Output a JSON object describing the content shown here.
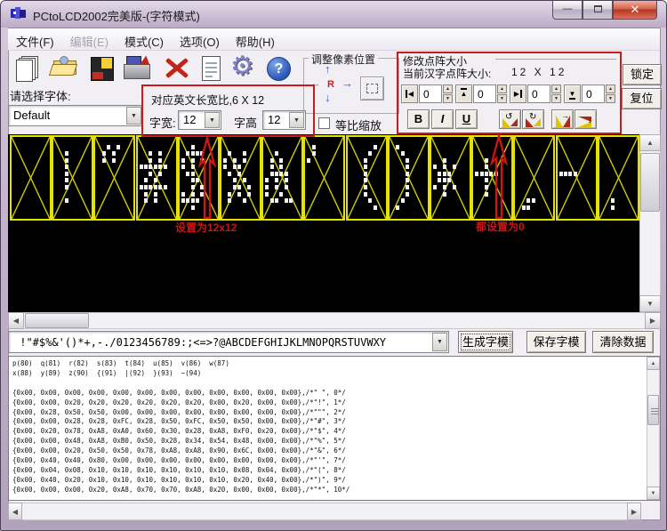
{
  "window": {
    "title": "PCtoLCD2002完美版-(字符模式)"
  },
  "menu": {
    "items": [
      {
        "label": "文件(F)",
        "enabled": true
      },
      {
        "label": "编辑(E)",
        "enabled": false
      },
      {
        "label": "模式(C)",
        "enabled": true
      },
      {
        "label": "选项(O)",
        "enabled": true
      },
      {
        "label": "帮助(H)",
        "enabled": true
      }
    ]
  },
  "toolbar": {
    "icons": [
      "new-file",
      "open-file",
      "save",
      "export-save",
      "delete",
      "notes",
      "settings",
      "help"
    ]
  },
  "font_select": {
    "label": "请选择字体:",
    "value": "Default"
  },
  "char_size_box": {
    "ratio_text": "对应英文长宽比,6 X 12",
    "width_label": "字宽:",
    "width_value": "12",
    "height_label": "字高",
    "height_value": "12"
  },
  "scale_checkbox": {
    "label": "等比缩放",
    "checked": false
  },
  "pixel_pos_group": {
    "title": "调整像素位置",
    "center_label": "R"
  },
  "matrix_box": {
    "title": "修改点阵大小",
    "current_label": "当前汉字点阵大小:",
    "current_value": "12 X 12",
    "margins": [
      {
        "name": "left",
        "value": "0"
      },
      {
        "name": "top",
        "value": "0"
      },
      {
        "name": "right",
        "value": "0"
      },
      {
        "name": "bottom",
        "value": "0"
      }
    ],
    "style_buttons": [
      "B",
      "I",
      "U"
    ]
  },
  "lock_button": "锁定",
  "reset_button": "复位",
  "annotations": {
    "size_note": "设置为12x12",
    "zero_note": "都设置为0"
  },
  "display": {
    "glyphs": [
      {
        "char": " ",
        "rows": [
          "0x00",
          "0x00",
          "0x00",
          "0x00",
          "0x00",
          "0x00",
          "0x00",
          "0x00",
          "0x00",
          "0x00",
          "0x00",
          "0x00"
        ]
      },
      {
        "char": "!",
        "rows": [
          "0x00",
          "0x00",
          "0x20",
          "0x20",
          "0x20",
          "0x20",
          "0x20",
          "0x20",
          "0x00",
          "0x20",
          "0x00",
          "0x00"
        ]
      },
      {
        "char": "\"",
        "rows": [
          "0x00",
          "0x28",
          "0x50",
          "0x50",
          "0x00",
          "0x00",
          "0x00",
          "0x00",
          "0x00",
          "0x00",
          "0x00",
          "0x00"
        ]
      },
      {
        "char": "#",
        "rows": [
          "0x00",
          "0x00",
          "0x28",
          "0x28",
          "0xFC",
          "0x28",
          "0x50",
          "0xFC",
          "0x50",
          "0x50",
          "0x00",
          "0x00"
        ]
      },
      {
        "char": "$",
        "rows": [
          "0x00",
          "0x20",
          "0x78",
          "0xA8",
          "0xA0",
          "0x60",
          "0x30",
          "0x28",
          "0xA8",
          "0xF0",
          "0x20",
          "0x00"
        ]
      },
      {
        "char": "%",
        "rows": [
          "0x00",
          "0x00",
          "0x48",
          "0xA8",
          "0xB0",
          "0x50",
          "0x28",
          "0x34",
          "0x54",
          "0x48",
          "0x00",
          "0x00"
        ]
      },
      {
        "char": "&",
        "rows": [
          "0x00",
          "0x00",
          "0x20",
          "0x50",
          "0x50",
          "0x78",
          "0xA8",
          "0xA8",
          "0x90",
          "0x6C",
          "0x00",
          "0x00"
        ]
      },
      {
        "char": "'",
        "rows": [
          "0x00",
          "0x40",
          "0x40",
          "0x80",
          "0x00",
          "0x00",
          "0x00",
          "0x00",
          "0x00",
          "0x00",
          "0x00",
          "0x00"
        ]
      },
      {
        "char": "(",
        "rows": [
          "0x00",
          "0x04",
          "0x08",
          "0x10",
          "0x10",
          "0x10",
          "0x10",
          "0x10",
          "0x10",
          "0x08",
          "0x04",
          "0x00"
        ]
      },
      {
        "char": ")",
        "rows": [
          "0x00",
          "0x40",
          "0x20",
          "0x10",
          "0x10",
          "0x10",
          "0x10",
          "0x10",
          "0x10",
          "0x20",
          "0x40",
          "0x00"
        ]
      },
      {
        "char": "*",
        "rows": [
          "0x00",
          "0x00",
          "0x00",
          "0x20",
          "0xA8",
          "0x70",
          "0x70",
          "0xA8",
          "0x20",
          "0x00",
          "0x00",
          "0x00"
        ]
      },
      {
        "char": "+",
        "rows": [
          "0x00",
          "0x00",
          "0x00",
          "0x20",
          "0x20",
          "0xF8",
          "0x20",
          "0x20",
          "0x20",
          "0x00",
          "0x00",
          "0x00"
        ]
      },
      {
        "char": ",",
        "rows": [
          "0x00",
          "0x00",
          "0x00",
          "0x00",
          "0x00",
          "0x00",
          "0x00",
          "0x00",
          "0x00",
          "0x30",
          "0x60",
          "0x00"
        ]
      },
      {
        "char": "-",
        "rows": [
          "0x00",
          "0x00",
          "0x00",
          "0x00",
          "0x00",
          "0xF0",
          "0x00",
          "0x00",
          "0x00",
          "0x00",
          "0x00",
          "0x00"
        ]
      },
      {
        "char": ".",
        "rows": [
          "0x00",
          "0x00",
          "0x00",
          "0x00",
          "0x00",
          "0x00",
          "0x00",
          "0x00",
          "0x00",
          "0x20",
          "0x20",
          "0x00"
        ]
      }
    ]
  },
  "char_list": {
    "value": " !\"#$%&'()*+,-./0123456789:;<=>?@ABCDEFGHIJKLMNOPQRSTUVWXY"
  },
  "action_buttons": {
    "generate": "生成字模",
    "save": "保存字模",
    "clear": "清除数据"
  },
  "code_output": {
    "lines": [
      "p(80)  q(81)  r(82)  s(83)  t(84)  u(85)  v(86)  w(87)",
      "x(88)  y(89)  z(90)  {(91)  |(92)  }(93)  ~(94)",
      "",
      "{0x00, 0x00, 0x00, 0x00, 0x00, 0x00, 0x00, 0x00, 0x00, 0x00, 0x00, 0x00},/*\" \", 0*/",
      "{0x00, 0x00, 0x20, 0x20, 0x20, 0x20, 0x20, 0x20, 0x00, 0x20, 0x00, 0x00},/*\"!\", 1*/",
      "{0x00, 0x28, 0x50, 0x50, 0x00, 0x00, 0x00, 0x00, 0x00, 0x00, 0x00, 0x00},/*\"\"\", 2*/",
      "{0x00, 0x00, 0x28, 0x28, 0xFC, 0x28, 0x50, 0xFC, 0x50, 0x50, 0x00, 0x00},/*\"#\", 3*/",
      "{0x00, 0x20, 0x78, 0xA8, 0xA0, 0x60, 0x30, 0x28, 0xA8, 0xF0, 0x20, 0x00},/*\"$\", 4*/",
      "{0x00, 0x00, 0x48, 0xA8, 0xB0, 0x50, 0x28, 0x34, 0x54, 0x48, 0x00, 0x00},/*\"%\", 5*/",
      "{0x00, 0x00, 0x20, 0x50, 0x50, 0x78, 0xA8, 0xA8, 0x90, 0x6C, 0x00, 0x00},/*\"&\", 6*/",
      "{0x00, 0x40, 0x40, 0x80, 0x00, 0x00, 0x00, 0x00, 0x00, 0x00, 0x00, 0x00},/*\"'\", 7*/",
      "{0x00, 0x04, 0x08, 0x10, 0x10, 0x10, 0x10, 0x10, 0x10, 0x08, 0x04, 0x00},/*\"(\", 8*/",
      "{0x00, 0x40, 0x20, 0x10, 0x10, 0x10, 0x10, 0x10, 0x10, 0x20, 0x40, 0x00},/*\")\", 9*/",
      "{0x00, 0x00, 0x00, 0x20, 0xA8, 0x70, 0x70, 0xA8, 0x20, 0x00, 0x00, 0x00},/*\"*\", 10*/"
    ]
  }
}
